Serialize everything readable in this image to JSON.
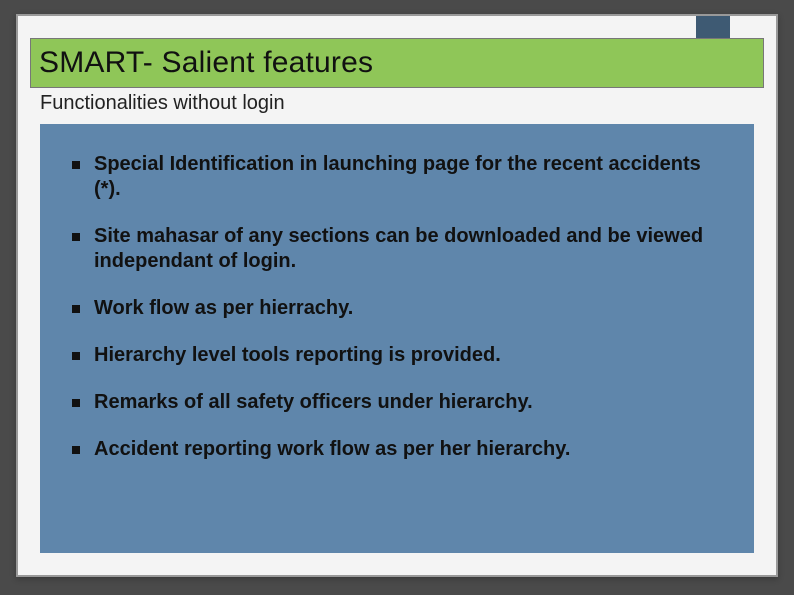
{
  "title": "SMART- Salient features",
  "subtitle": "Functionalities  without login",
  "bullets": [
    "Special Identification  in launching page for the recent accidents (*).",
    "Site mahasar of any sections can be downloaded and be viewed independant of login.",
    "Work flow as per hierrachy.",
    "Hierarchy level tools reporting is provided.",
    "Remarks of all safety officers under hierarchy.",
    "Accident  reporting  work flow as per her hierarchy."
  ],
  "colors": {
    "slide_bg": "#4a4a4a",
    "inner_bg": "#f4f4f4",
    "title_bar": "#8fc658",
    "content_panel": "#5f86ab",
    "deco_block": "#3e5a73"
  }
}
